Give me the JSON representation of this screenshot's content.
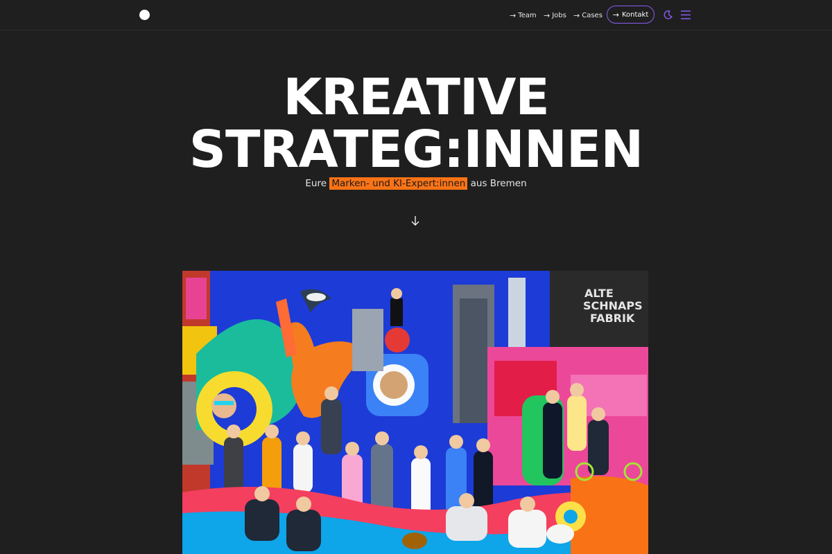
{
  "header": {
    "nav": [
      {
        "label": "Team"
      },
      {
        "label": "Jobs"
      },
      {
        "label": "Cases"
      }
    ],
    "contact_label": "Kontakt",
    "icons": {
      "logo": "logo-dot",
      "nav_arrow": "arrow-right-icon",
      "theme": "moon-icon",
      "menu": "hamburger-menu-icon"
    },
    "accent_color": "#8b5cf6"
  },
  "hero": {
    "title_line1": "KREATIVE",
    "title_line2": "STRATEG:INNEN",
    "subtitle_before": "Eure",
    "subtitle_highlight": "Marken- und KI-Expert:innen",
    "subtitle_after": "aus Bremen",
    "highlight_color": "#f97316",
    "scroll_icon": "arrow-down-icon"
  },
  "collage": {
    "building_sign": [
      "ALTE",
      "SCHNAPS",
      "FABRIK"
    ]
  }
}
